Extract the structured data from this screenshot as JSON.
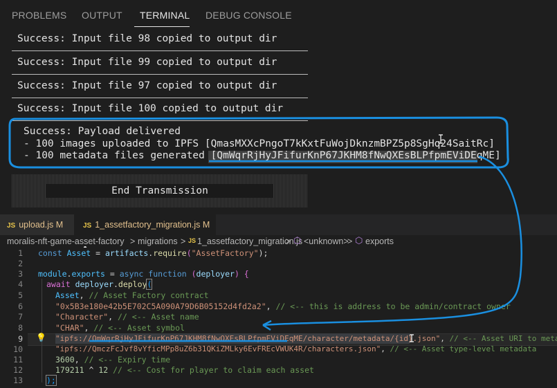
{
  "panel": {
    "tabs": [
      "PROBLEMS",
      "OUTPUT",
      "TERMINAL",
      "DEBUG CONSOLE"
    ],
    "active_tab": "TERMINAL"
  },
  "terminal": {
    "lines": [
      "Success: Input file 98 copied to output dir",
      "Success: Input file 99 copied to output dir",
      "Success: Input file 97 copied to output dir",
      "Success: Input file 100 copied to output dir"
    ],
    "payload": {
      "title": "Success: Payload delivered",
      "images_prefix": "- 100 images uploaded to IPFS [",
      "images_cid": "QmasMXXcPngoT7kKxtFuWojDknzmBPZ5p8SgHq24SaitRc",
      "close_bracket": "]",
      "metadata_prefix": "- 100 metadata files generated [",
      "metadata_cid": "QmWqrRjHyJFifurKnP67JKHM8fNwQXEsBLPfpmEViDEqME"
    },
    "end_transmission": "End Transmission"
  },
  "editor": {
    "tabs": [
      {
        "icon": "JS",
        "name": "upload.js",
        "status": "M"
      },
      {
        "icon": "JS",
        "name": "1_assetfactory_migration.js",
        "status": "M",
        "modified_dot": "●"
      }
    ],
    "breadcrumb": {
      "folder": "moralis-nft-game-asset-factory",
      "sep": ">",
      "subfolder": "migrations",
      "file_icon": "JS",
      "file": "1_assetfactory_migration.js",
      "symbol1": "<unknown>",
      "symbol2": "exports"
    },
    "line_numbers": [
      "1",
      "2",
      "3",
      "4",
      "5",
      "6",
      "7",
      "8",
      "9",
      "10",
      "11",
      "12",
      "13"
    ],
    "code": {
      "l1": {
        "kw": "const",
        "var": "Asset",
        "eq": " = ",
        "obj": "artifacts",
        "dot": ".",
        "fn": "require",
        "open": "(",
        "str": "\"AssetFactory\"",
        "close": ");"
      },
      "l3": {
        "obj": "module",
        "dot": ".",
        "prop": "exports",
        "eq": " = ",
        "kw1": "async",
        "kw2": "function",
        "open": " (",
        "param": "deployer",
        "close": ") {"
      },
      "l4": {
        "kw": "await",
        "obj": "deployer",
        "dot": ".",
        "fn": "deploy",
        "open": "("
      },
      "l5": {
        "var": "Asset",
        "punc": ", ",
        "cm": "// Asset Factory contract"
      },
      "l6": {
        "str": "\"0x5B3e180e42b5E702C5A090A79D6B05152d4fd2a2\"",
        "punc": ", ",
        "cm": "// <-- this is address to be admin/contract owner"
      },
      "l7": {
        "str": "\"Character\"",
        "punc": ", ",
        "cm": "// <-- Asset name"
      },
      "l8": {
        "str": "\"CHAR\"",
        "punc": ", ",
        "cm": "// <-- Asset symbol"
      },
      "l9": {
        "str": "\"ipfs://QmWqrRjHyJFifurKnP67JKHM8fNwQXEsBLPfpmEViDEqME/character/metadata/{id}.json\"",
        "punc": ", ",
        "cm": "// <-- Asset URI to metadata"
      },
      "l10": {
        "str": "\"ipfs://QmczFcJvf8vYficMPp8uZ6b31QKiZMLky6EvFREcVWUK4R/characters.json\"",
        "punc": ", ",
        "cm": "// <-- Asset type-level metadata"
      },
      "l11": {
        "num": "3600",
        "punc": ", ",
        "cm": "// <-- Expiry time"
      },
      "l12": {
        "num1": "179211",
        "op": " ^ ",
        "num2": "12",
        "punc": " ",
        "cm": "// <-- Cost for player to claim each asset"
      },
      "l13": {
        "close": ");"
      }
    },
    "lightbulb": "💡"
  },
  "colors": {
    "annotation_blue": "#1a8fe0",
    "background": "#1e1e1e"
  }
}
